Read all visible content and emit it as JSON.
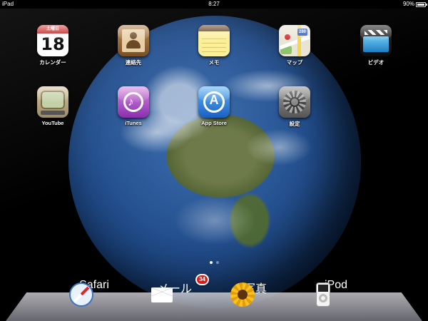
{
  "status_bar": {
    "carrier": "iPad",
    "time": "8:27",
    "battery": "90%",
    "battery_level": 0.9
  },
  "home": {
    "apps": [
      {
        "label": "カレンダー",
        "icon": "calendar-icon",
        "weekday": "土曜日",
        "day": "18"
      },
      {
        "label": "連絡先",
        "icon": "contacts-icon"
      },
      {
        "label": "メモ",
        "icon": "notes-icon"
      },
      {
        "label": "マップ",
        "icon": "maps-icon",
        "shield": "280"
      },
      {
        "label": "ビデオ",
        "icon": "video-icon"
      },
      {
        "label": "YouTube",
        "icon": "youtube-icon"
      },
      {
        "label": "iTunes",
        "icon": "itunes-icon"
      },
      {
        "label": "App Store",
        "icon": "app-store-icon"
      },
      {
        "label": "設定",
        "icon": "settings-icon"
      }
    ],
    "page_count": 2,
    "current_page": 1
  },
  "dock": {
    "apps": [
      {
        "label": "Safari",
        "icon": "safari-icon"
      },
      {
        "label": "メール",
        "icon": "mail-icon",
        "badge": "34"
      },
      {
        "label": "写真",
        "icon": "photos-icon"
      },
      {
        "label": "iPod",
        "icon": "ipod-icon"
      }
    ]
  },
  "wallpaper": {
    "icon": "earth-wallpaper"
  }
}
